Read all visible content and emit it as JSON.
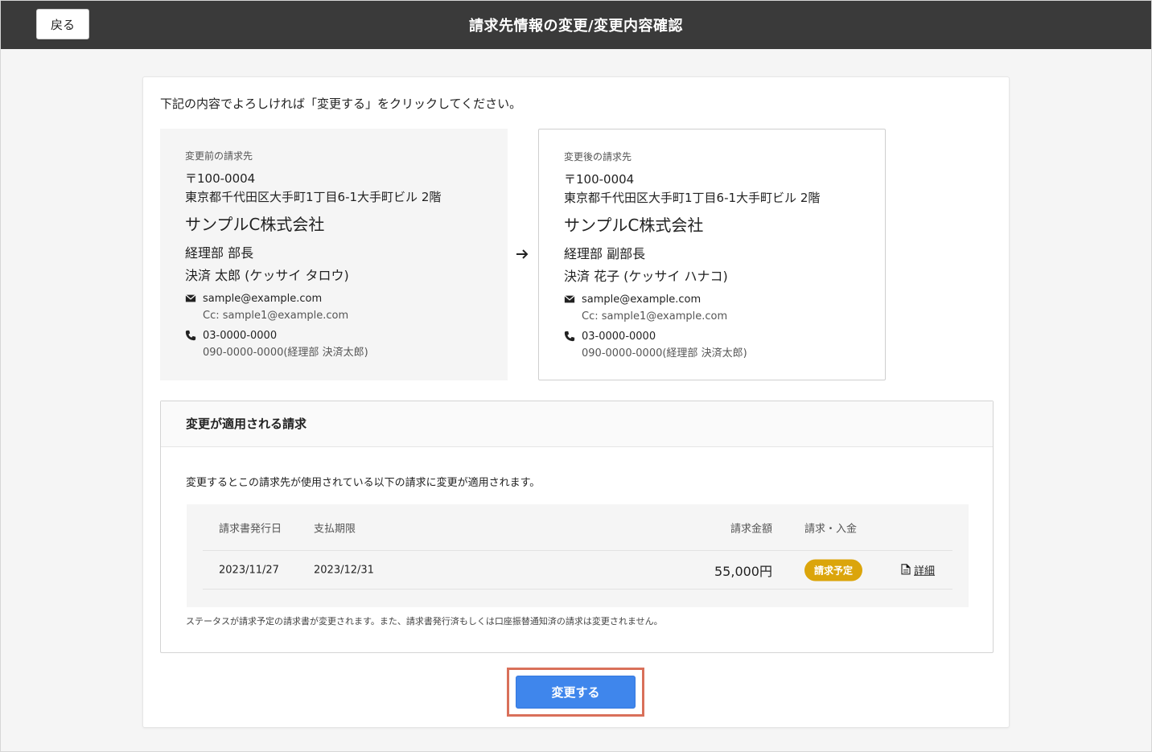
{
  "header": {
    "back_label": "戻る",
    "title": "請求先情報の変更/変更内容確認"
  },
  "main": {
    "instruction": "下記の内容でよろしければ「変更する」をクリックしてください。",
    "before": {
      "label": "変更前の請求先",
      "postal": "〒100-0004",
      "address": "東京都千代田区大手町1丁目6-1大手町ビル 2階",
      "company": "サンプルC株式会社",
      "department": "経理部 部長",
      "person": "決済 太郎 (ケッサイ タロウ)",
      "email": "sample@example.com",
      "cc": "Cc: sample1@example.com",
      "phone": "03-0000-0000",
      "phone2": "090-0000-0000(経理部 決済太郎)"
    },
    "after": {
      "label": "変更後の請求先",
      "postal": "〒100-0004",
      "address": "東京都千代田区大手町1丁目6-1大手町ビル 2階",
      "company": "サンプルC株式会社",
      "department": "経理部 副部長",
      "person": "決済 花子 (ケッサイ ハナコ)",
      "email": "sample@example.com",
      "cc": "Cc: sample1@example.com",
      "phone": "03-0000-0000",
      "phone2": "090-0000-0000(経理部 決済太郎)"
    },
    "section": {
      "title": "変更が適用される請求",
      "description": "変更するとこの請求先が使用されている以下の請求に変更が適用されます。",
      "table": {
        "headers": {
          "issue_date": "請求書発行日",
          "due_date": "支払期限",
          "amount": "請求金額",
          "status": "請求・入金"
        },
        "rows": [
          {
            "issue_date": "2023/11/27",
            "due_date": "2023/12/31",
            "amount": "55,000円",
            "status": "請求予定",
            "detail": "詳細"
          }
        ]
      },
      "note": "ステータスが請求予定の請求書が変更されます。また、請求書発行済もしくは口座振替通知済の請求は変更されません。"
    },
    "submit_label": "変更する"
  },
  "colors": {
    "topbar": "#3a3a3a",
    "primary": "#3f86ec",
    "badge": "#dba50b",
    "highlight": "#d9705a"
  },
  "icons": [
    "mail-icon",
    "phone-icon",
    "arrow-right-icon",
    "document-icon"
  ]
}
